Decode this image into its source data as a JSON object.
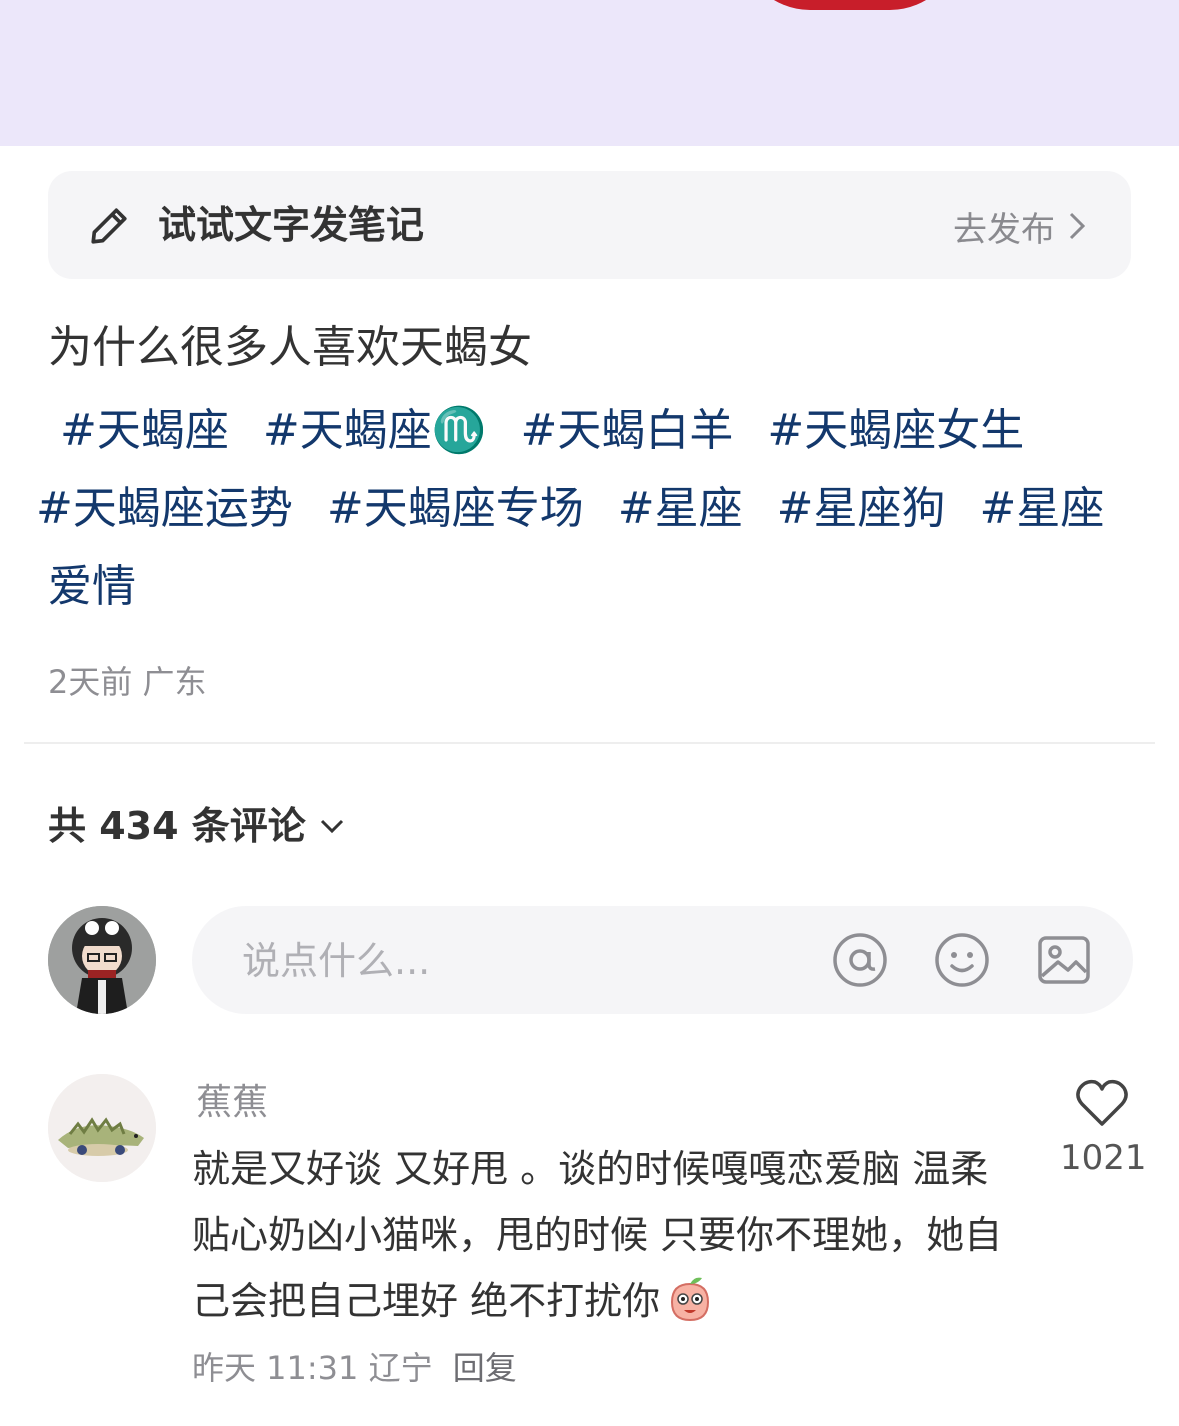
{
  "prompt_bar": {
    "text": "试试文字发笔记",
    "action": "去发布"
  },
  "post": {
    "title": "为什么很多人喜欢天蝎女",
    "tags": [
      "#天蝎座",
      "#天蝎座♏️",
      "#天蝎白羊",
      "#天蝎座女生",
      "#天蝎座运势",
      "#天蝎座专场",
      "#星座",
      "#星座狗",
      "#星座爱情"
    ],
    "time": "2天前",
    "location": "广东"
  },
  "comments_header": {
    "label": "共 434 条评论"
  },
  "comment_input": {
    "placeholder": "说点什么..."
  },
  "comments": [
    {
      "user": "蕉蕉",
      "text": "就是又好谈 又好甩 。谈的时候嘎嘎恋爱脑 温柔贴心奶凶小猫咪，甩的时候 只要你不理她，她自己会把自己埋好 绝不打扰你",
      "time": "昨天 11:31",
      "location": "辽宁",
      "reply_label": "回复",
      "likes": "1021"
    }
  ],
  "colors": {
    "tag": "#13386c",
    "cover": "#ece7fa",
    "muted": "#8e8e93"
  },
  "icons": [
    "pencil-icon",
    "chevron-right-icon",
    "chevron-down-icon",
    "at-icon",
    "emoji-icon",
    "image-icon",
    "heart-icon"
  ]
}
